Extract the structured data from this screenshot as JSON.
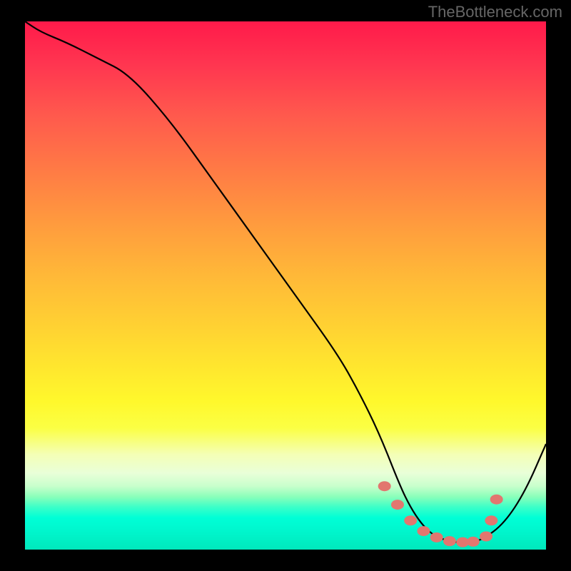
{
  "attribution": "TheBottleneck.com",
  "chart_data": {
    "type": "line",
    "title": "",
    "xlabel": "",
    "ylabel": "",
    "xlim": [
      0,
      100
    ],
    "ylim": [
      0,
      100
    ],
    "series": [
      {
        "name": "bottleneck-curve",
        "x": [
          0,
          3,
          8,
          14,
          20,
          28,
          36,
          44,
          52,
          60,
          64,
          68,
          72,
          74,
          76,
          78,
          80,
          82,
          84,
          86,
          88,
          92,
          96,
          100
        ],
        "y": [
          100,
          98,
          96,
          93,
          90,
          81,
          70,
          59,
          48,
          37,
          30,
          22,
          12,
          8,
          5,
          3,
          2,
          1.5,
          1.3,
          1.5,
          2,
          5,
          11,
          20
        ],
        "color": "#000000"
      }
    ],
    "markers": {
      "name": "optimal-range-dots",
      "x": [
        69,
        71.5,
        74,
        76.5,
        79,
        81.5,
        84,
        86,
        88.5,
        89.5,
        90.5
      ],
      "y": [
        12,
        8.5,
        5.5,
        3.5,
        2.3,
        1.6,
        1.4,
        1.5,
        2.5,
        5.5,
        9.5
      ],
      "color": "#e2766f"
    },
    "gradient_stops": [
      {
        "pos": 0,
        "color": "#ff1a4a"
      },
      {
        "pos": 50,
        "color": "#ffd232"
      },
      {
        "pos": 80,
        "color": "#fbff44"
      },
      {
        "pos": 100,
        "color": "#00e8bc"
      }
    ]
  }
}
